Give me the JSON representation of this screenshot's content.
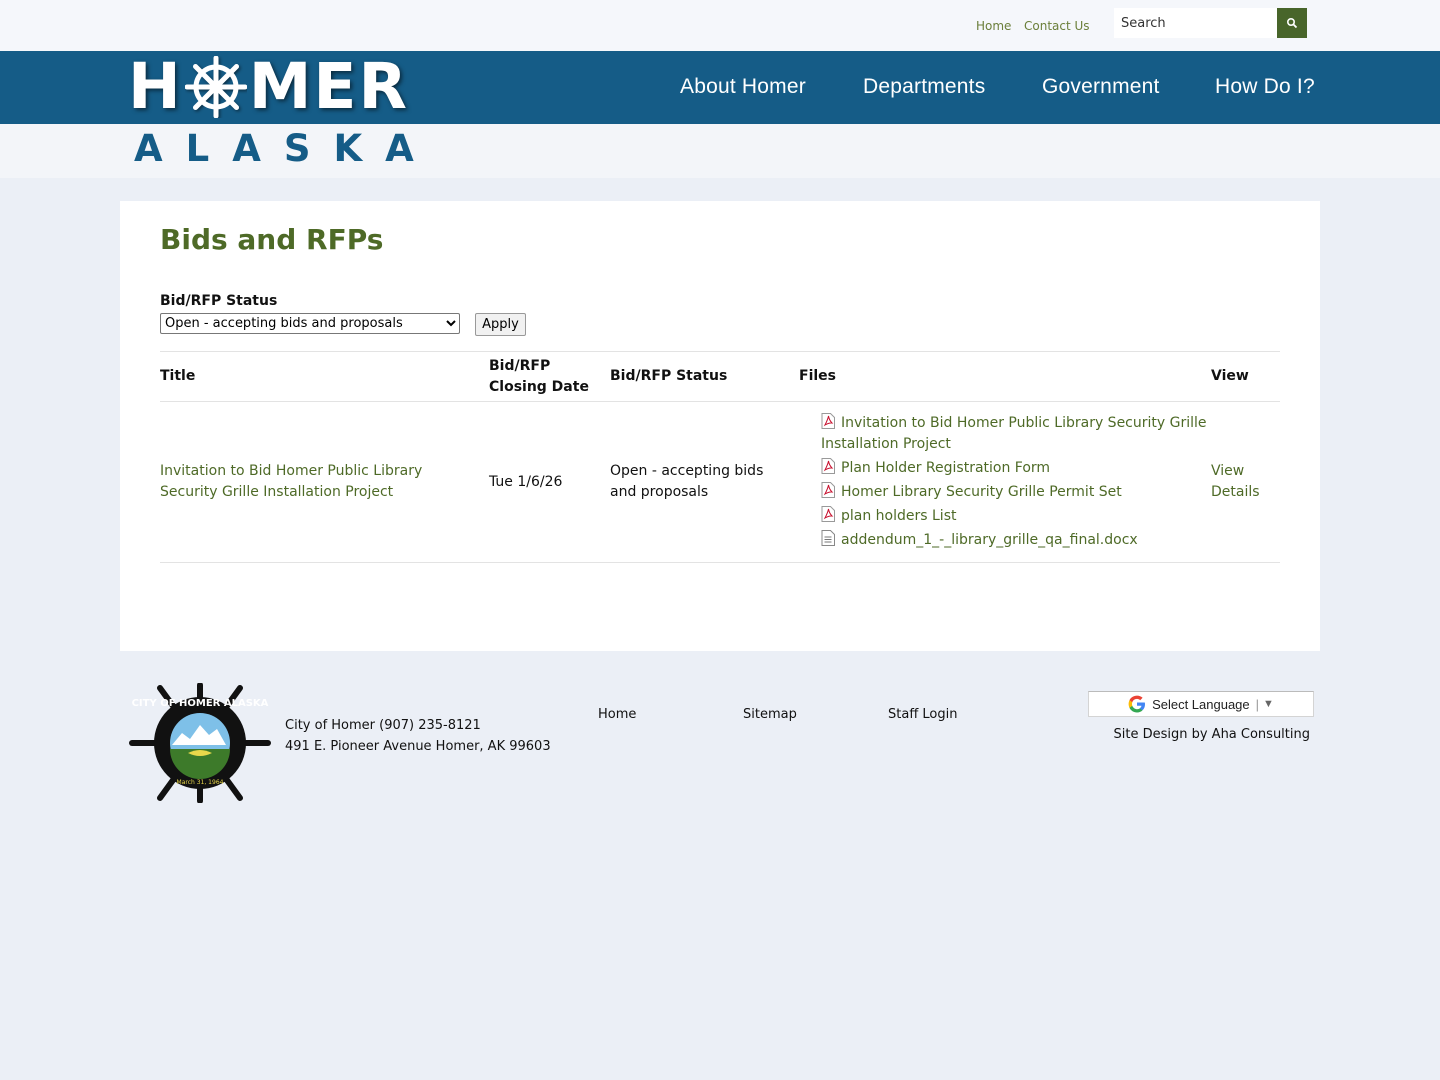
{
  "utility": {
    "links": [
      "Home",
      "Contact Us"
    ],
    "search_placeholder": "Search"
  },
  "logo": {
    "top_word_left": "H",
    "top_word_right": "MER",
    "bottom_word": "ALASKA"
  },
  "nav": {
    "items": [
      "About Homer",
      "Departments",
      "Government",
      "How Do I?"
    ]
  },
  "page": {
    "title": "Bids and RFPs",
    "filter_label": "Bid/RFP Status",
    "filter_selected": "Open - accepting bids and proposals",
    "apply_label": "Apply"
  },
  "table": {
    "headers": {
      "title": "Title",
      "closing_line1": "Bid/RFP",
      "closing_line2": "Closing Date",
      "status": "Bid/RFP Status",
      "files": "Files",
      "view": "View"
    },
    "rows": [
      {
        "title": "Invitation to Bid Homer Public Library Security Grille Installation Project",
        "closing_date": "Tue 1/6/26",
        "status": "Open - accepting bids and proposals",
        "files": [
          {
            "name": "Invitation to Bid Homer Public Library Security Grille Installation Project",
            "icon": "pdf-icon"
          },
          {
            "name": "Plan Holder Registration Form",
            "icon": "pdf-icon"
          },
          {
            "name": "Homer Library Security Grille Permit Set",
            "icon": "pdf-icon"
          },
          {
            "name": "plan holders List",
            "icon": "pdf-icon"
          },
          {
            "name": "addendum_1_-_library_grille_qa_final.docx",
            "icon": "doc-icon"
          }
        ],
        "view_label": "View Details"
      }
    ]
  },
  "footer": {
    "address_line1": "City of Homer (907) 235-8121",
    "address_line2": "491 E. Pioneer Avenue Homer, AK 99603",
    "links": [
      "Home",
      "Sitemap",
      "Staff Login"
    ],
    "translate_label": "Select Language",
    "credit": "Site Design by Aha Consulting",
    "seal_text_top": "CITY OF HOMER ALASKA",
    "seal_date": "March 31, 1964"
  },
  "colors": {
    "nav_blue": "#155c87",
    "link_green": "#4e6a27",
    "search_button": "#48652a",
    "page_bg": "#ebeff6"
  }
}
